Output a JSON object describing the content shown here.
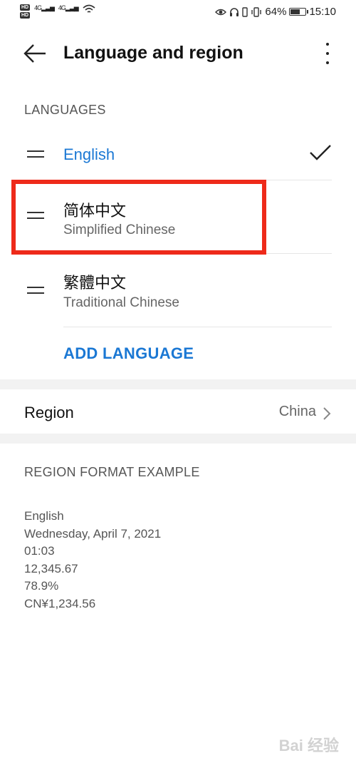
{
  "status_bar": {
    "hd1": "HD",
    "hd2": "HD",
    "sig1": "4G",
    "sig2": "4G",
    "battery_text": "64%",
    "battery_level": 0.64,
    "time": "15:10"
  },
  "header": {
    "title": "Language and region"
  },
  "languages": {
    "section_label": "LANGUAGES",
    "items": [
      {
        "name": "English",
        "subtitle": "",
        "selected": true
      },
      {
        "name": "简体中文",
        "subtitle": "Simplified Chinese",
        "selected": false
      },
      {
        "name": "繁體中文",
        "subtitle": "Traditional Chinese",
        "selected": false
      }
    ],
    "add_label": "ADD LANGUAGE"
  },
  "region": {
    "label": "Region",
    "value": "China"
  },
  "region_format": {
    "section_label": "REGION FORMAT EXAMPLE",
    "lines": [
      "English",
      "Wednesday, April 7, 2021",
      "01:03",
      "12,345.67",
      "78.9%",
      "CN¥1,234.56"
    ]
  },
  "colors": {
    "accent": "#1b78d4",
    "highlight": "#ee2a1a"
  },
  "watermark": "Bai 经验"
}
